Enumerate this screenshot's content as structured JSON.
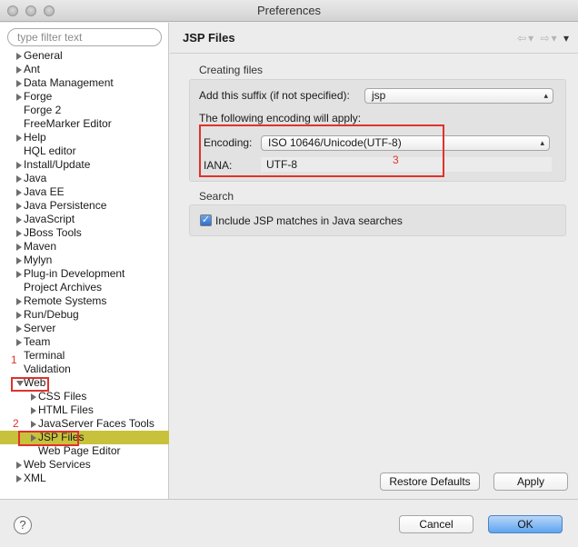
{
  "window": {
    "title": "Preferences"
  },
  "filter": {
    "placeholder": "type filter text"
  },
  "tree": {
    "items": [
      {
        "label": "General",
        "arrow": "right",
        "indent": 0
      },
      {
        "label": "Ant",
        "arrow": "right",
        "indent": 0
      },
      {
        "label": "Data Management",
        "arrow": "right",
        "indent": 0
      },
      {
        "label": "Forge",
        "arrow": "right",
        "indent": 0
      },
      {
        "label": "Forge 2",
        "arrow": "none",
        "indent": 0
      },
      {
        "label": "FreeMarker Editor",
        "arrow": "none",
        "indent": 0
      },
      {
        "label": "Help",
        "arrow": "right",
        "indent": 0
      },
      {
        "label": "HQL editor",
        "arrow": "none",
        "indent": 0
      },
      {
        "label": "Install/Update",
        "arrow": "right",
        "indent": 0
      },
      {
        "label": "Java",
        "arrow": "right",
        "indent": 0
      },
      {
        "label": "Java EE",
        "arrow": "right",
        "indent": 0
      },
      {
        "label": "Java Persistence",
        "arrow": "right",
        "indent": 0
      },
      {
        "label": "JavaScript",
        "arrow": "right",
        "indent": 0
      },
      {
        "label": "JBoss Tools",
        "arrow": "right",
        "indent": 0
      },
      {
        "label": "Maven",
        "arrow": "right",
        "indent": 0
      },
      {
        "label": "Mylyn",
        "arrow": "right",
        "indent": 0
      },
      {
        "label": "Plug-in Development",
        "arrow": "right",
        "indent": 0
      },
      {
        "label": "Project Archives",
        "arrow": "none",
        "indent": 0
      },
      {
        "label": "Remote Systems",
        "arrow": "right",
        "indent": 0
      },
      {
        "label": "Run/Debug",
        "arrow": "right",
        "indent": 0
      },
      {
        "label": "Server",
        "arrow": "right",
        "indent": 0
      },
      {
        "label": "Team",
        "arrow": "right",
        "indent": 0
      },
      {
        "label": "Terminal",
        "arrow": "none",
        "indent": 0
      },
      {
        "label": "Validation",
        "arrow": "none",
        "indent": 0
      },
      {
        "label": "Web",
        "arrow": "down",
        "indent": 0
      },
      {
        "label": "CSS Files",
        "arrow": "right",
        "indent": 1
      },
      {
        "label": "HTML Files",
        "arrow": "right",
        "indent": 1
      },
      {
        "label": "JavaServer Faces Tools",
        "arrow": "right",
        "indent": 1
      },
      {
        "label": "JSP Files",
        "arrow": "right",
        "indent": 1,
        "selected": true
      },
      {
        "label": "Web Page Editor",
        "arrow": "none",
        "indent": 1
      },
      {
        "label": "Web Services",
        "arrow": "right",
        "indent": 0
      },
      {
        "label": "XML",
        "arrow": "right",
        "indent": 0
      }
    ]
  },
  "annotations": {
    "mark1": "1",
    "mark2": "2",
    "mark3": "3"
  },
  "page": {
    "title": "JSP Files",
    "creating_files": {
      "section_label": "Creating files",
      "suffix_label": "Add this suffix (if not specified):",
      "suffix_value": "jsp",
      "encoding_note": "The following encoding will apply:",
      "encoding_label": "Encoding:",
      "encoding_value": "ISO 10646/Unicode(UTF-8)",
      "iana_label": "IANA:",
      "iana_value": "UTF-8"
    },
    "search": {
      "section_label": "Search",
      "checkbox_label": "Include JSP matches in Java searches",
      "checked": true
    },
    "restore_defaults": "Restore Defaults",
    "apply": "Apply"
  },
  "footer": {
    "help": "?",
    "cancel": "Cancel",
    "ok": "OK"
  },
  "colors": {
    "selection": "#c8c13c",
    "annotation_red": "#e0322b",
    "primary_button": "#5ea4ef"
  }
}
